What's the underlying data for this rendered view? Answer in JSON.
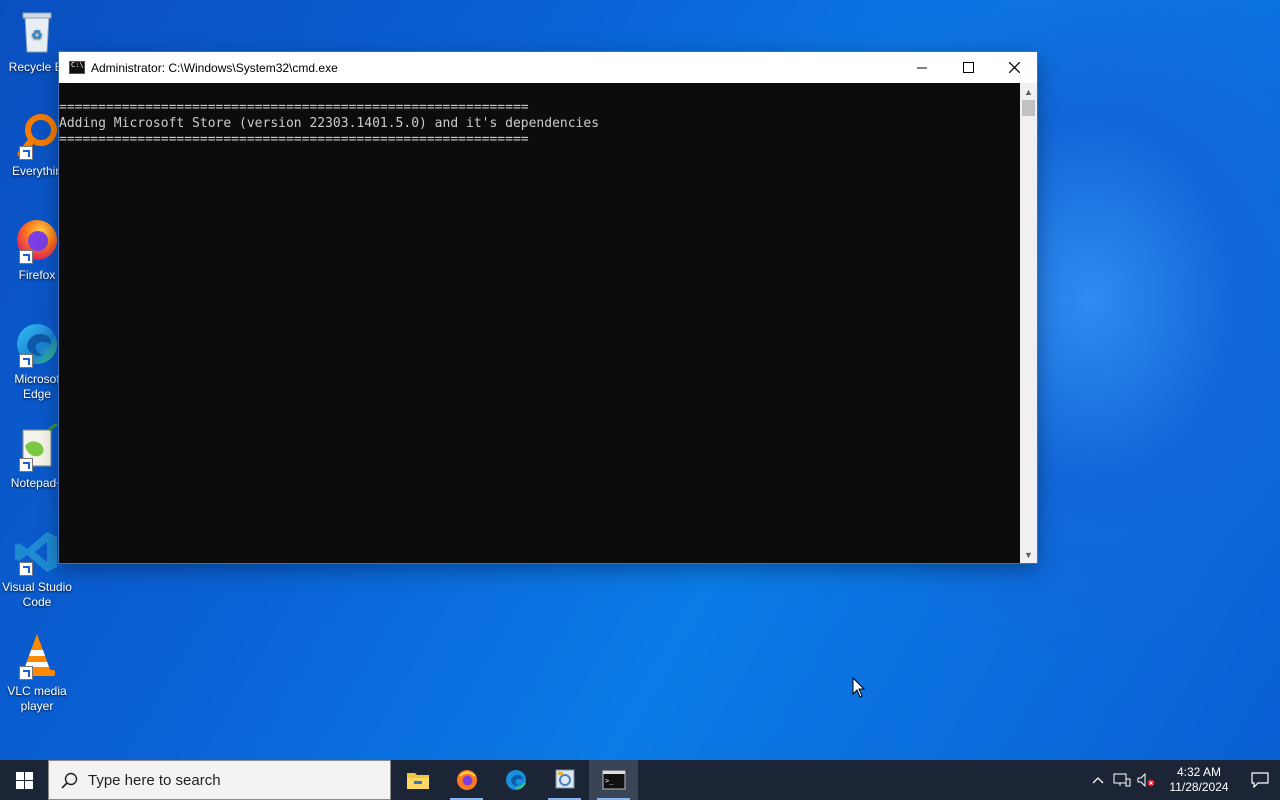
{
  "desktop": {
    "icons": [
      {
        "label": "Recycle Bin",
        "visible_label": "Recycle Bi",
        "icon": "recycle-bin-icon"
      },
      {
        "label": "Everything",
        "visible_label": "Everythin",
        "icon": "everything-icon"
      },
      {
        "label": "Firefox",
        "visible_label": "Firefox",
        "icon": "firefox-icon"
      },
      {
        "label": "Microsoft Edge",
        "visible_label": "Microsof\nEdge",
        "icon": "edge-icon"
      },
      {
        "label": "Notepad++",
        "visible_label": "Notepad+",
        "icon": "notepadpp-icon"
      },
      {
        "label": "Visual Studio Code",
        "visible_label": "Visual Studio\nCode",
        "icon": "vscode-icon"
      },
      {
        "label": "VLC media player",
        "visible_label": "VLC media\nplayer",
        "icon": "vlc-icon"
      }
    ]
  },
  "window": {
    "title": "Administrator: C:\\Windows\\System32\\cmd.exe",
    "controls": {
      "minimize": "—",
      "maximize": "☐",
      "close": "✕"
    },
    "console_lines": [
      "============================================================",
      "Adding Microsoft Store (version 22303.1401.5.0) and it's dependencies",
      "============================================================"
    ]
  },
  "taskbar": {
    "search_placeholder": "Type here to search",
    "pinned": [
      "file-explorer-icon",
      "firefox-icon",
      "edge-icon",
      "control-panel-icon",
      "cmd-icon"
    ],
    "clock": {
      "time": "4:32 AM",
      "date": "11/28/2024"
    }
  },
  "colors": {
    "console_bg": "#0c0c0c",
    "console_text": "#cccccc",
    "taskbar_bg": "#1c2536"
  }
}
